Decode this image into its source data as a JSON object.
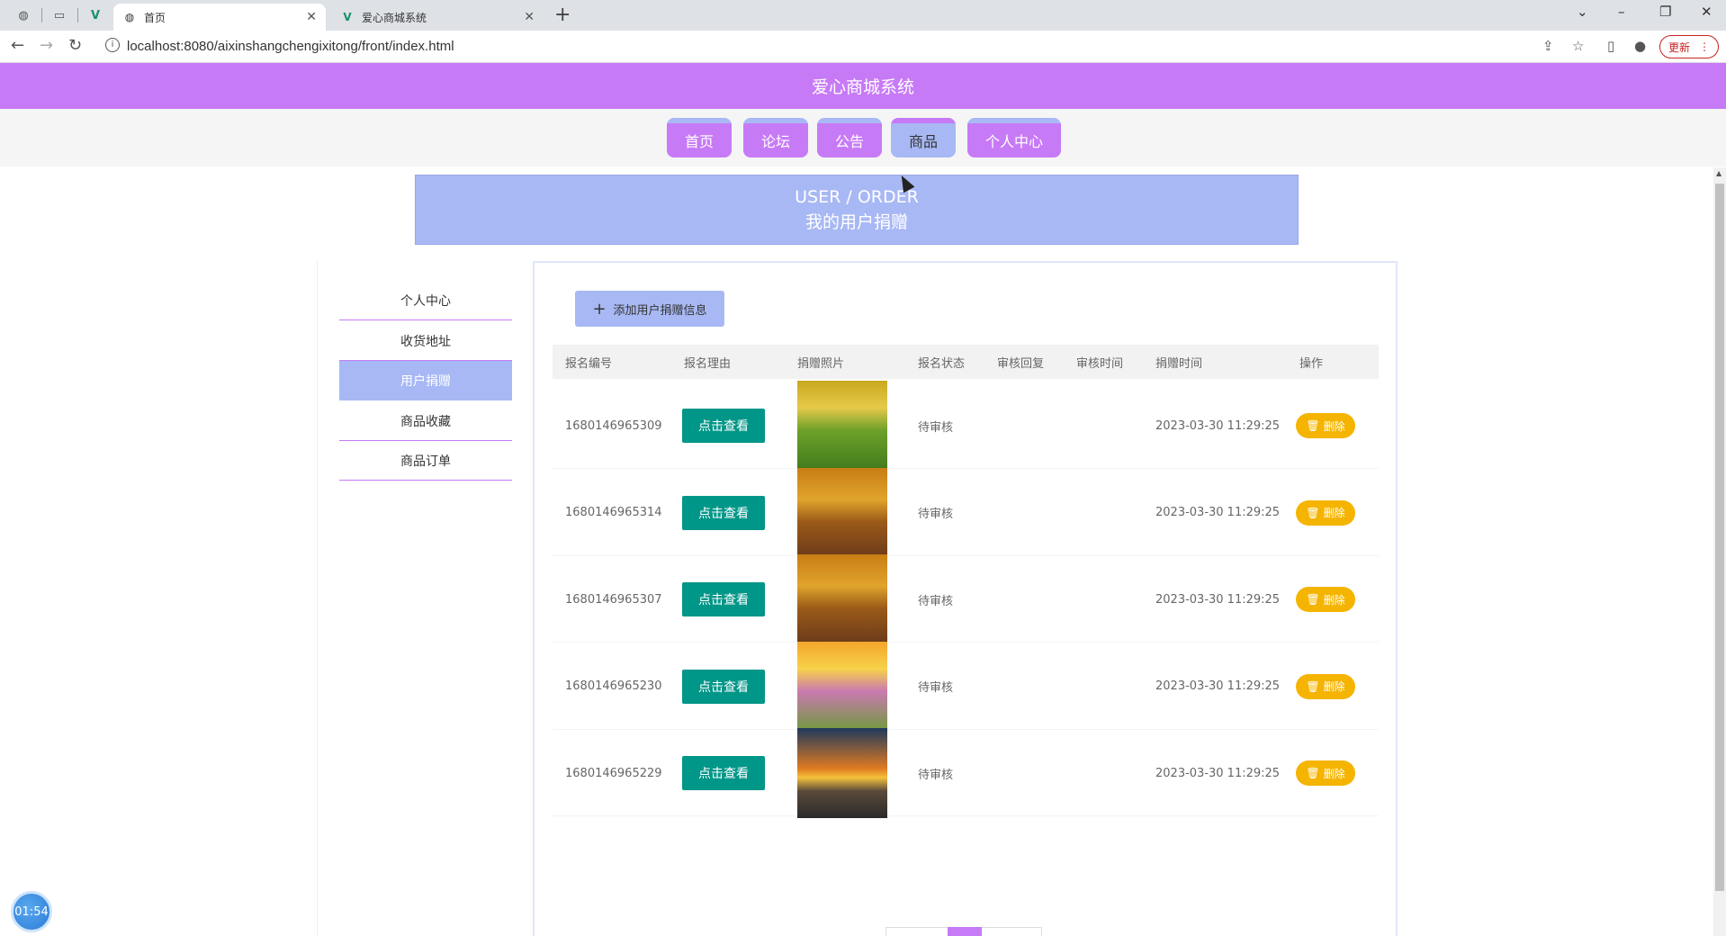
{
  "browser": {
    "tabs": [
      {
        "title": "首页",
        "active": true
      },
      {
        "title": "爱心商城系统",
        "active": false
      }
    ],
    "url": "localhost:8080/aixinshangchengixitong/front/index.html",
    "update_label": "更新"
  },
  "site": {
    "title": "爱心商城系统",
    "nav": [
      "首页",
      "论坛",
      "公告",
      "商品",
      "个人中心"
    ],
    "active_nav": "商品",
    "accent_color": "#c77af6",
    "secondary_color": "#a8b8f4"
  },
  "banner": {
    "en": "USER / ORDER",
    "zh": "我的用户捐赠"
  },
  "sidebar": {
    "items": [
      "个人中心",
      "收货地址",
      "用户捐赠",
      "商品收藏",
      "商品订单"
    ],
    "active": "用户捐赠"
  },
  "toolbar": {
    "add_label": "添加用户捐赠信息"
  },
  "table": {
    "columns": [
      "报名编号",
      "报名理由",
      "捐赠照片",
      "报名状态",
      "审核回复",
      "审核时间",
      "捐赠时间",
      "操作"
    ],
    "view_label": "点击查看",
    "delete_label": "删除",
    "rows": [
      {
        "id": "1680146965309",
        "status": "待审核",
        "reply": "",
        "review_time": "",
        "donate_time": "2023-03-30 11:29:25",
        "photo": "flower-field"
      },
      {
        "id": "1680146965314",
        "status": "待审核",
        "reply": "",
        "review_time": "",
        "donate_time": "2023-03-30 11:29:25",
        "photo": "autumn-road"
      },
      {
        "id": "1680146965307",
        "status": "待审核",
        "reply": "",
        "review_time": "",
        "donate_time": "2023-03-30 11:29:25",
        "photo": "autumn-road"
      },
      {
        "id": "1680146965230",
        "status": "待审核",
        "reply": "",
        "review_time": "",
        "donate_time": "2023-03-30 11:29:25",
        "photo": "sunset-meadow"
      },
      {
        "id": "1680146965229",
        "status": "待审核",
        "reply": "",
        "review_time": "",
        "donate_time": "2023-03-30 11:29:25",
        "photo": "sunset-road"
      }
    ]
  },
  "timer": "01:54"
}
